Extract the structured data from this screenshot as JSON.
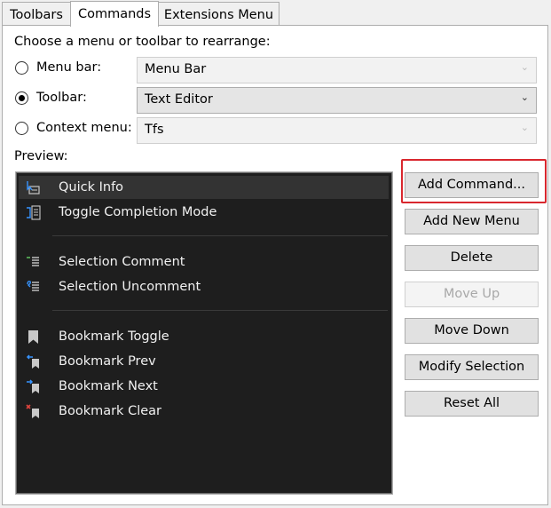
{
  "tabs": [
    {
      "label": "Toolbars"
    },
    {
      "label": "Commands"
    },
    {
      "label": "Extensions Menu"
    }
  ],
  "choose_label": "Choose a menu or toolbar to rearrange:",
  "options": {
    "menu_bar": {
      "label": "Menu bar:",
      "value": "Menu Bar",
      "checked": false
    },
    "toolbar": {
      "label": "Toolbar:",
      "value": "Text Editor",
      "checked": true
    },
    "context_menu": {
      "label": "Context menu:",
      "value": "Tfs",
      "checked": false
    }
  },
  "preview_label": "Preview:",
  "preview_items": [
    {
      "label": "Quick Info",
      "icon": "quick-info-icon"
    },
    {
      "label": "Toggle Completion Mode",
      "icon": "toggle-completion-icon"
    },
    {
      "label": "Selection Comment",
      "icon": "comment-icon"
    },
    {
      "label": "Selection Uncomment",
      "icon": "uncomment-icon"
    },
    {
      "label": "Bookmark Toggle",
      "icon": "bookmark-icon"
    },
    {
      "label": "Bookmark Prev",
      "icon": "bookmark-prev-icon"
    },
    {
      "label": "Bookmark Next",
      "icon": "bookmark-next-icon"
    },
    {
      "label": "Bookmark Clear",
      "icon": "bookmark-clear-icon"
    }
  ],
  "buttons": {
    "add_command": "Add Command...",
    "add_new_menu": "Add New Menu",
    "delete": "Delete",
    "move_up": "Move Up",
    "move_down": "Move Down",
    "modify_selection": "Modify Selection",
    "reset_all": "Reset All"
  },
  "colors": {
    "highlight": "#d9272e",
    "preview_bg": "#1e1e1e",
    "icon_blue": "#3794ff",
    "icon_red": "#e0443e"
  }
}
